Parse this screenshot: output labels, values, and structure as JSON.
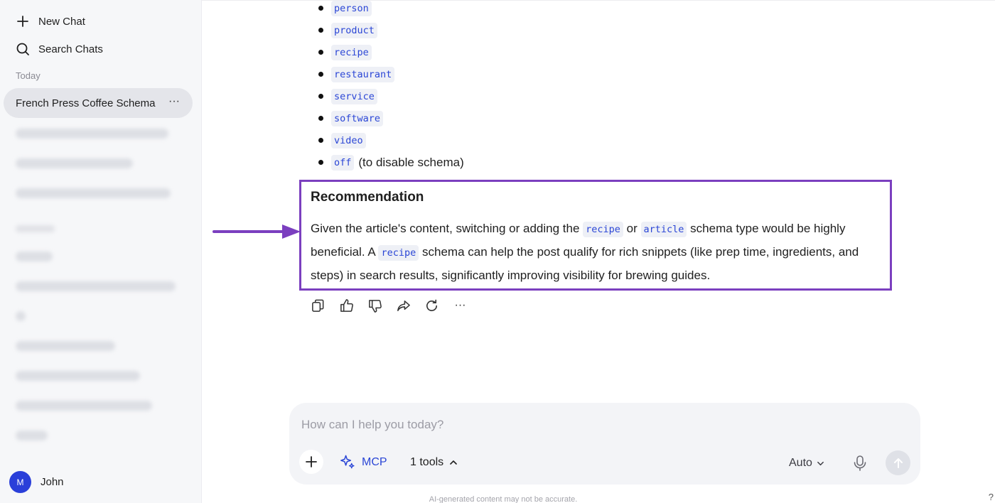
{
  "sidebar": {
    "new_chat": "New Chat",
    "search_chats": "Search Chats",
    "section_today": "Today",
    "active_chat": "French Press Coffee Schema",
    "active_more": "···",
    "user_initial": "M",
    "user_name": "John"
  },
  "main": {
    "bullets": [
      {
        "code": "person",
        "after": ""
      },
      {
        "code": "product",
        "after": ""
      },
      {
        "code": "recipe",
        "after": ""
      },
      {
        "code": "restaurant",
        "after": ""
      },
      {
        "code": "service",
        "after": ""
      },
      {
        "code": "software",
        "after": ""
      },
      {
        "code": "video",
        "after": ""
      },
      {
        "code": "off",
        "after": "(to disable schema)"
      }
    ],
    "recommendation": {
      "title": "Recommendation",
      "p1": "Given the article's content, switching or adding the",
      "code1": "recipe",
      "p2": "or",
      "code2": "article",
      "p3": "schema type would be highly beneficial. A",
      "code3": "recipe",
      "p4": "schema can help the post qualify for rich snippets (like prep time, ingredients, and steps) in search results, significantly improving visibility for brewing guides."
    },
    "actions": [
      "copy-icon",
      "thumbs-up-icon",
      "thumbs-down-icon",
      "share-icon",
      "regenerate-icon",
      "more-icon"
    ],
    "more_label": "···"
  },
  "composer": {
    "placeholder": "How can I help you today?",
    "mcp_label": "MCP",
    "tools_label": "1 tools",
    "model_label": "Auto"
  },
  "footer": {
    "disclaimer": "AI-generated content may not be accurate.",
    "help": "?"
  },
  "colors": {
    "accent": "#2b46d6",
    "highlight_border": "#7b3fbf",
    "avatar": "#2a3fd9"
  }
}
